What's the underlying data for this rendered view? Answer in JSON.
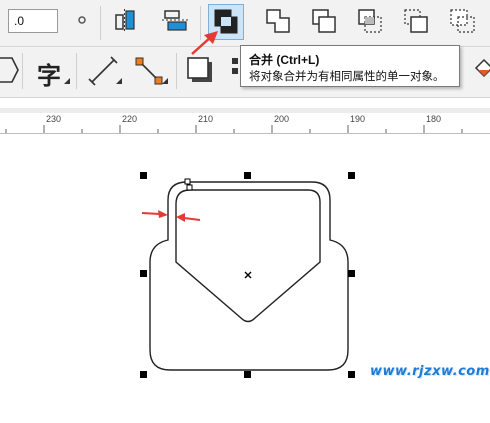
{
  "toolbar1": {
    "numeric_value": ".0",
    "buttons": [
      {
        "name": "outline-width-icon"
      },
      {
        "name": "align-horizontal-icon"
      },
      {
        "name": "align-vertical-icon"
      },
      {
        "name": "combine-icon"
      },
      {
        "name": "weld-icon"
      },
      {
        "name": "trim-icon"
      },
      {
        "name": "intersect-icon"
      },
      {
        "name": "simplify-icon"
      },
      {
        "name": "front-minus-back-icon"
      }
    ]
  },
  "toolbar2": {
    "text_tool_glyph": "字"
  },
  "tooltip": {
    "title": "合并 (Ctrl+L)",
    "description": "将对象合并为有相同属性的单一对象。"
  },
  "ruler": {
    "ticks": [
      "230",
      "220",
      "210",
      "200",
      "190",
      "180"
    ]
  },
  "watermark": {
    "text": "www.rjzxw.com"
  },
  "colors": {
    "accent_blue": "#1e90d8",
    "arrow_red": "#e53935",
    "watermark_blue": "#1e7bd6"
  }
}
